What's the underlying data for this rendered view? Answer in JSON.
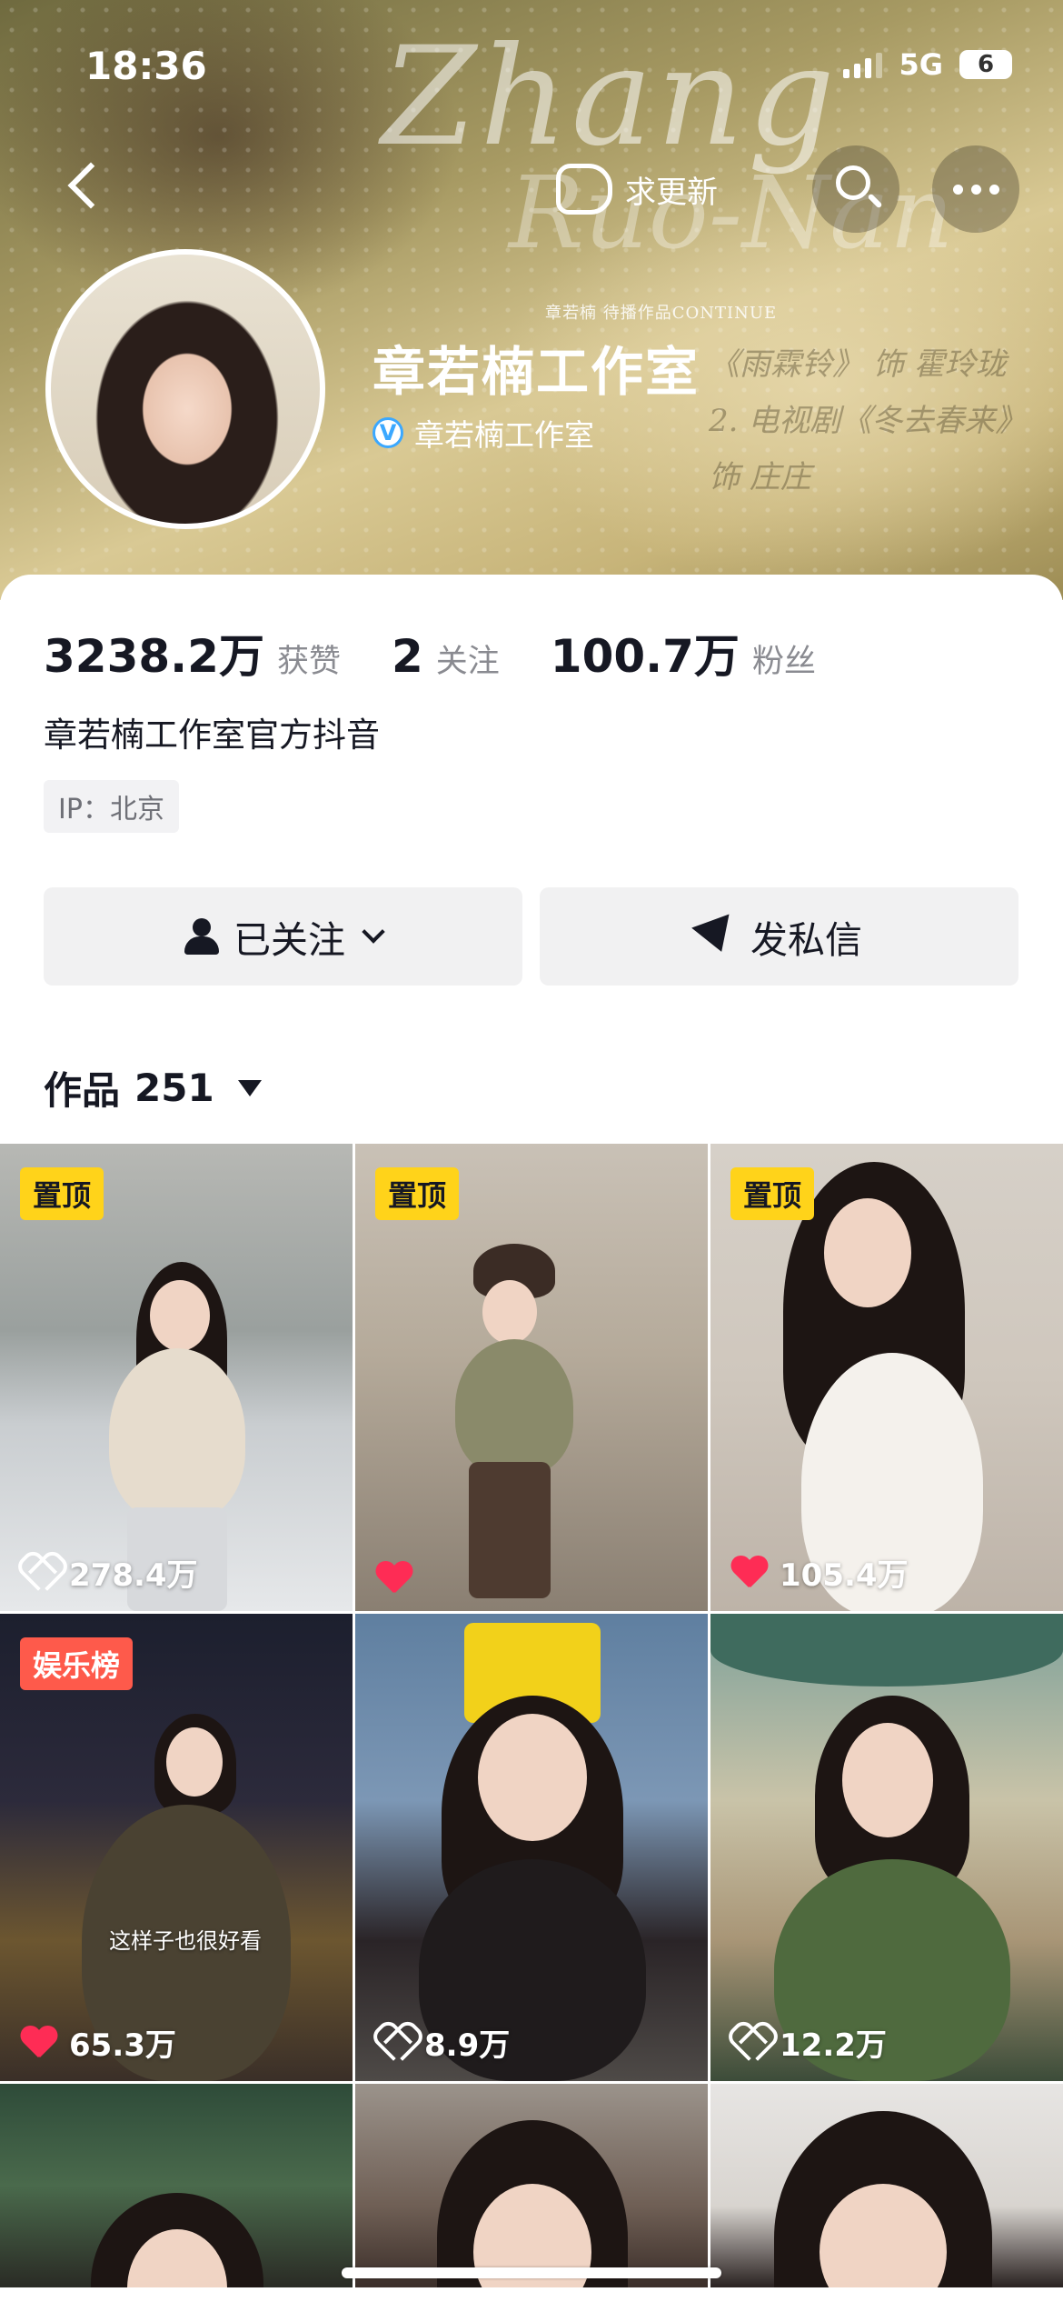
{
  "status_bar": {
    "time": "18:36",
    "network": "5G",
    "battery": "6"
  },
  "header": {
    "update_label": "求更新",
    "banner_script": "Zhang",
    "banner_script2": "Ruo-Nan",
    "banner_caption": "章若楠  待播作品CONTINUE",
    "banner_works": [
      "《雨霖铃》 饰 霍玲珑",
      "2. 电视剧《冬去春来》 饰 庄庄"
    ]
  },
  "profile": {
    "name": "章若楠工作室",
    "verified_name": "章若楠工作室",
    "stats": [
      {
        "value": "3238.2万",
        "label": "获赞"
      },
      {
        "value": "2",
        "label": "关注"
      },
      {
        "value": "100.7万",
        "label": "粉丝"
      }
    ],
    "bio": "章若楠工作室官方抖音",
    "ip": "IP：北京",
    "follow_label": "已关注",
    "message_label": "发私信",
    "works_label": "作品",
    "works_count": "251"
  },
  "videos": [
    {
      "badge": "置顶",
      "badge_type": "pin",
      "likes": "278.4万",
      "liked": false
    },
    {
      "badge": "置顶",
      "badge_type": "pin",
      "likes": "",
      "liked": true
    },
    {
      "badge": "置顶",
      "badge_type": "pin",
      "likes": "105.4万",
      "liked": true
    },
    {
      "badge": "娱乐榜",
      "badge_type": "ent",
      "likes": "65.3万",
      "liked": true,
      "caption": "这样子也很好看"
    },
    {
      "badge": "",
      "badge_type": "",
      "likes": "8.9万",
      "liked": false
    },
    {
      "badge": "",
      "badge_type": "",
      "likes": "12.2万",
      "liked": false
    }
  ]
}
